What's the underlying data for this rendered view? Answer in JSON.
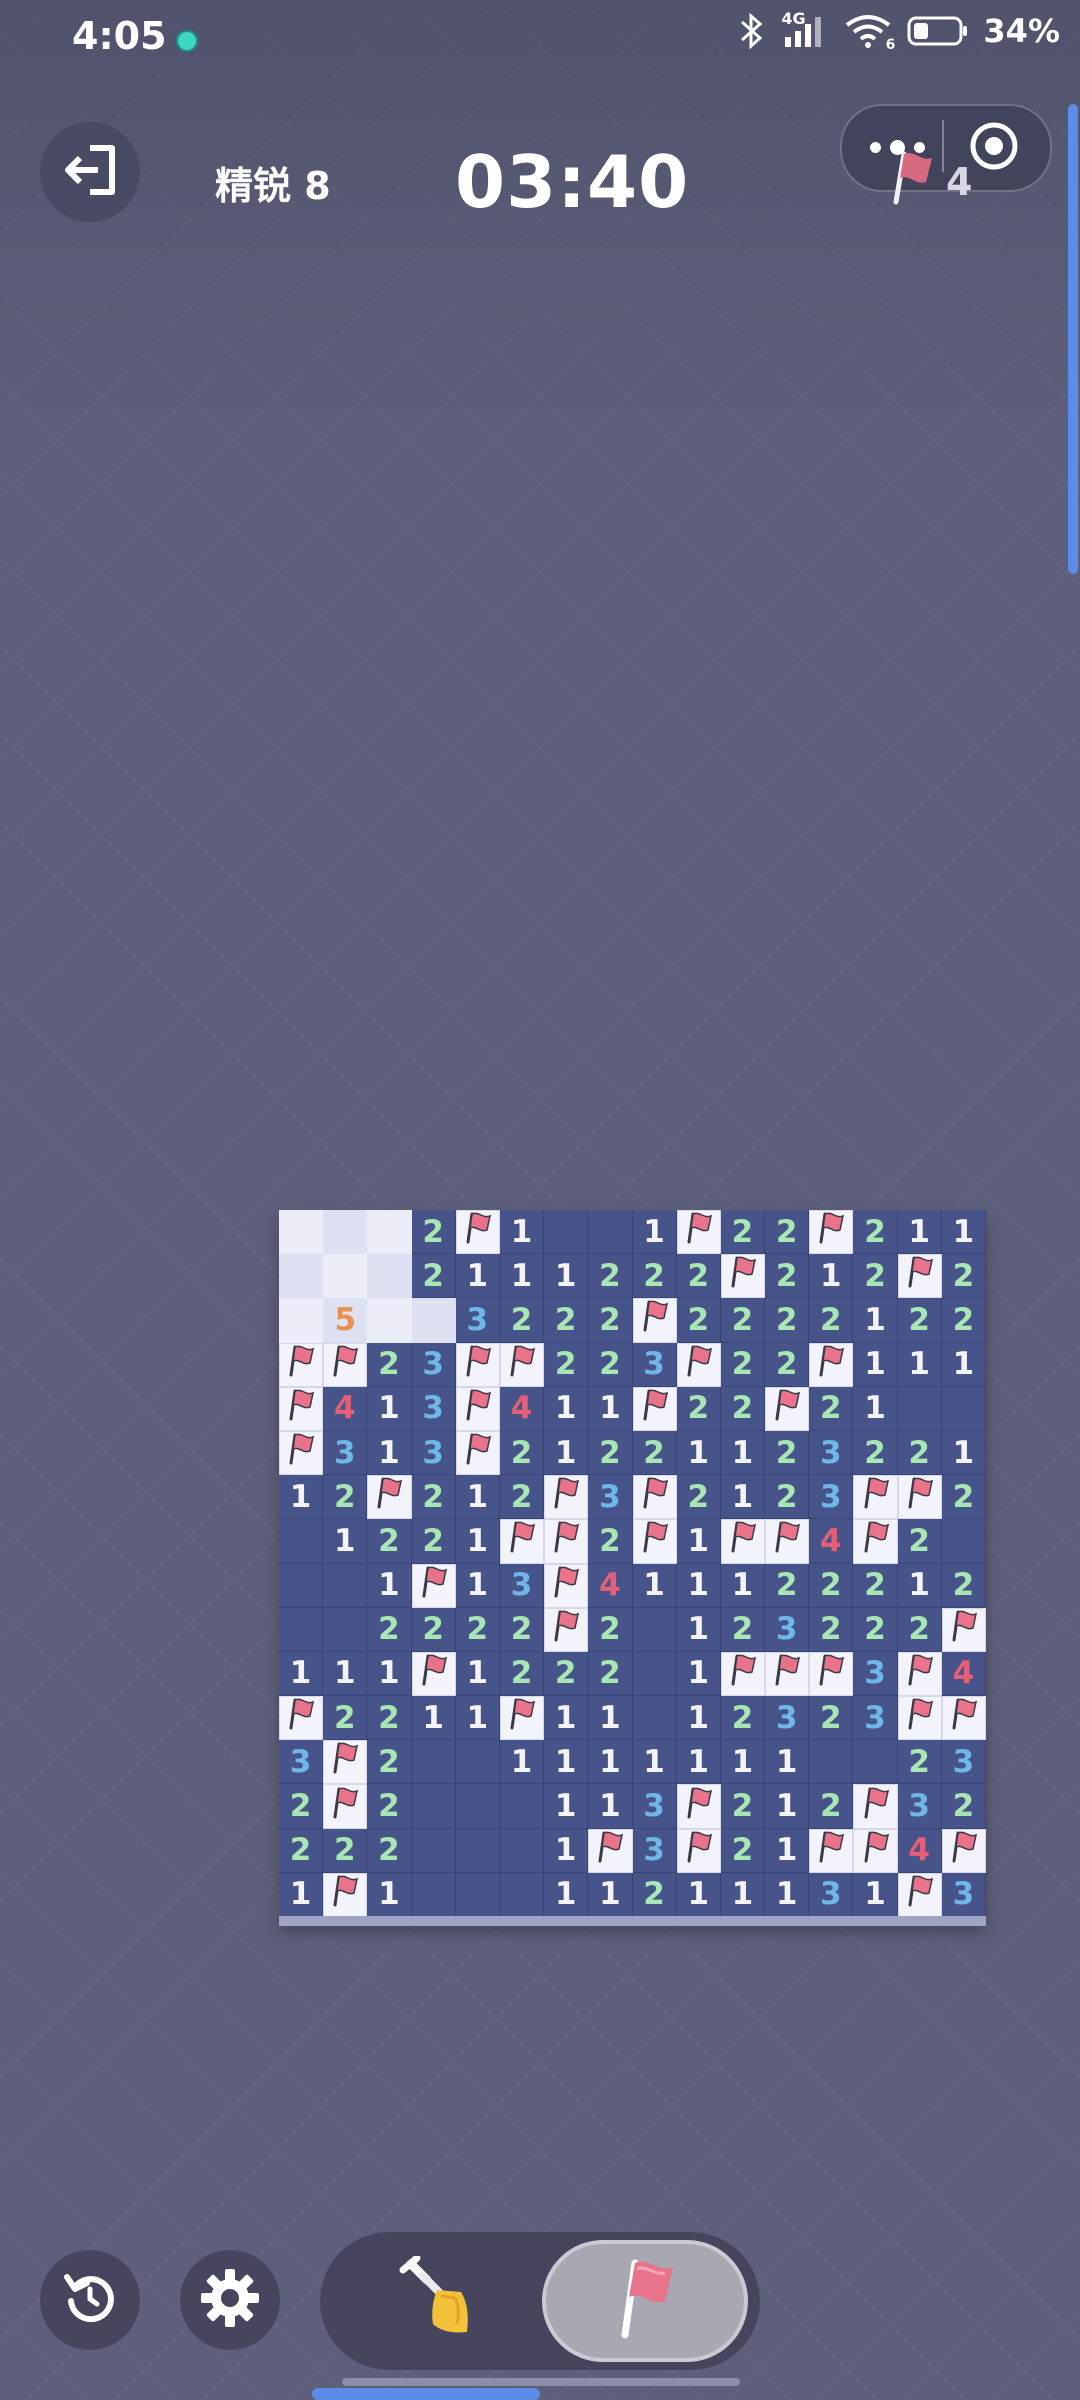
{
  "status_bar": {
    "time": "4:05",
    "network": "4G",
    "wifi_badge": "6",
    "battery_percent": "34%",
    "icons": [
      "bluetooth-icon",
      "signal-icon",
      "wifi-icon",
      "battery-icon"
    ]
  },
  "header": {
    "exit_icon": "exit-icon",
    "level": "精锐 8",
    "timer": "03:40",
    "menu_icon": "more-dots-icon",
    "target_icon": "target-icon",
    "flags_remaining": "4"
  },
  "board": {
    "cols": 16,
    "rows": 16,
    "legend": {
      "H": "unrevealed",
      "F": "flag",
      ".": "revealed-empty"
    },
    "grid": [
      "HHH2F1..1F22F211",
      "HHH2111222F212F2",
      "H5HH3222F2222122F",
      "FF23FF223F22F111",
      "F413F411F22F21..",
      "F313F21221123221.",
      "12F212F3F2123FF2.",
      ".1221FF2F1FF4F2.",
      "..1F13F4111222121",
      "..2222F2.123222F",
      "111F1222.1FFF3F4",
      "F2211F11.12323FF",
      "3F2..1111111..233",
      "2F2...113F212F32",
      "222...1F3F21FF4F",
      "1F1...11211131F31"
    ]
  },
  "controls": {
    "restart_icon": "restart-icon",
    "settings_icon": "gear-icon",
    "dig_icon": "shovel-icon",
    "flag_icon": "flag-icon",
    "active_mode": "flag"
  },
  "colors": {
    "background": "#5e5f7a",
    "board": "#47548a",
    "flag_red": "#e8738a",
    "num1": "#f4f4f8",
    "num2": "#a8e6b4",
    "num3": "#6fb7e9",
    "num4": "#e45f78",
    "num5": "#e8914e",
    "accent_blue": "#5b8de8"
  }
}
